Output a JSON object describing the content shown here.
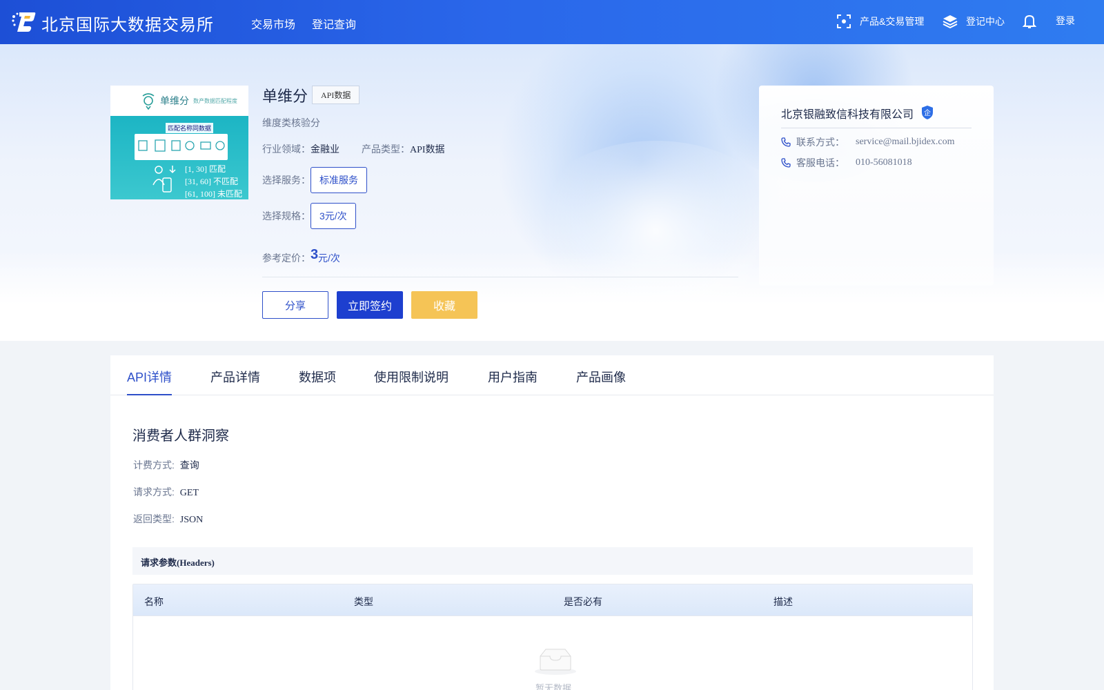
{
  "header": {
    "brand": "北京国际大数据交易所",
    "nav": [
      "交易市场",
      "登记查询"
    ],
    "product_mgmt": "产品&交易管理",
    "register_center": "登记中心",
    "login": "登录"
  },
  "product": {
    "title": "单维分",
    "badge": "API数据",
    "description": "维度类核验分",
    "industry_label": "行业领域：",
    "industry_value": "金融业",
    "type_label": "产品类型：",
    "type_value": "API数据",
    "service_label": "选择服务：",
    "service_option": "标准服务",
    "spec_label": "选择规格：",
    "spec_option": "3元/次",
    "price_label": "参考定价：",
    "price_value": "3",
    "price_unit": "元/次",
    "image": {
      "title": "单维分",
      "subtitle": "数产数据匹配程度",
      "caption": "匹配名称同数据",
      "ranges": [
        "[1, 30] 匹配",
        "[31, 60] 不匹配",
        "[61, 100] 未匹配"
      ]
    }
  },
  "actions": {
    "share": "分享",
    "sign": "立即签约",
    "favorite": "收藏"
  },
  "company": {
    "name": "北京银融致信科技有限公司",
    "badge": "企",
    "contact_label": "联系方式：",
    "contact_value": "service@mail.bjidex.com",
    "phone_label": "客服电话：",
    "phone_value": "010-56081018"
  },
  "tabs": [
    "API详情",
    "产品详情",
    "数据项",
    "使用限制说明",
    "用户指南",
    "产品画像"
  ],
  "api": {
    "section_title": "消费者人群洞察",
    "billing_label": "计费方式:",
    "billing_value": "查询",
    "method_label": "请求方式:",
    "method_value": "GET",
    "return_label": "返回类型:",
    "return_value": "JSON",
    "headers_title": "请求参数(Headers)",
    "columns": [
      "名称",
      "类型",
      "是否必有",
      "描述"
    ],
    "empty_text": "暂无数据"
  },
  "colors": {
    "primary": "#2d4fc9",
    "header_gradient_start": "#1d4fd6",
    "favorite": "#f5c456"
  }
}
